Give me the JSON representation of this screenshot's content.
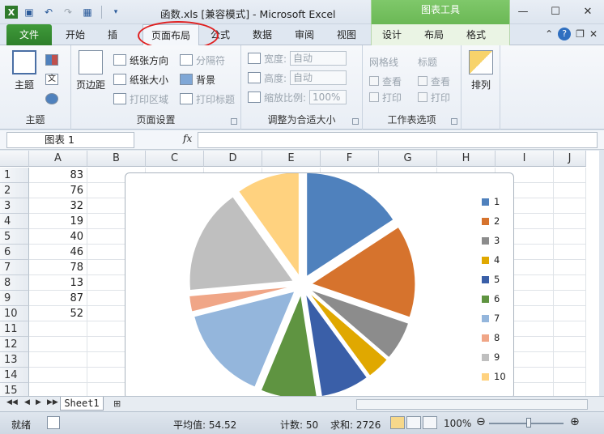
{
  "window": {
    "title": "函数.xls  [兼容模式]  -  Microsoft Excel",
    "tools_header": "图表工具"
  },
  "tabs": {
    "file": "文件",
    "home": "开始",
    "insert": "插",
    "page_layout": "页面布局",
    "formulas": "公式",
    "data": "数据",
    "review": "审阅",
    "view": "视图",
    "design": "设计",
    "layout": "布局",
    "format": "格式"
  },
  "ribbon": {
    "themes": {
      "theme_label": "主题",
      "group_label": "主题",
      "text_label": "文"
    },
    "page_setup": {
      "margins": "页边距",
      "orientation": "纸张方向",
      "size": "纸张大小",
      "print_area": "打印区域",
      "breaks": "分隔符",
      "background": "背景",
      "print_titles": "打印标题",
      "group_label": "页面设置"
    },
    "scale": {
      "width_label": "宽度:",
      "height_label": "高度:",
      "scale_label": "缩放比例:",
      "width_value": "自动",
      "height_value": "自动",
      "scale_value": "100%",
      "group_label": "调整为合适大小"
    },
    "sheet_options": {
      "gridlines": "网格线",
      "headings": "标题",
      "view": "查看",
      "print": "打印",
      "group_label": "工作表选项"
    },
    "arrange": {
      "label": "排列"
    }
  },
  "formula_bar": {
    "name_box": "图表 1",
    "fx": "fx",
    "formula": ""
  },
  "grid": {
    "columns": [
      "A",
      "B",
      "C",
      "D",
      "E",
      "F",
      "G",
      "H",
      "I",
      "J"
    ],
    "rows": [
      "1",
      "2",
      "3",
      "4",
      "5",
      "6",
      "7",
      "8",
      "9",
      "10",
      "11",
      "12",
      "13",
      "14",
      "15"
    ],
    "column_a": [
      "83",
      "76",
      "32",
      "19",
      "40",
      "46",
      "78",
      "13",
      "87",
      "52"
    ]
  },
  "chart_data": {
    "type": "pie",
    "categories": [
      "1",
      "2",
      "3",
      "4",
      "5",
      "6",
      "7",
      "8",
      "9",
      "10"
    ],
    "values": [
      83,
      76,
      32,
      19,
      40,
      46,
      78,
      13,
      87,
      52
    ],
    "colors": [
      "#4f81bd",
      "#d6732d",
      "#8c8c8c",
      "#e0a800",
      "#3a5fa8",
      "#5f9441",
      "#94b6dc",
      "#f0a687",
      "#bfbfbf",
      "#ffd27f"
    ],
    "legend_position": "right",
    "exploded": true
  },
  "sheets": {
    "active": "Sheet1"
  },
  "status": {
    "ready": "就绪",
    "average": "平均值: 54.52",
    "count": "计数: 50",
    "sum": "求和: 2726",
    "zoom": "100%"
  }
}
